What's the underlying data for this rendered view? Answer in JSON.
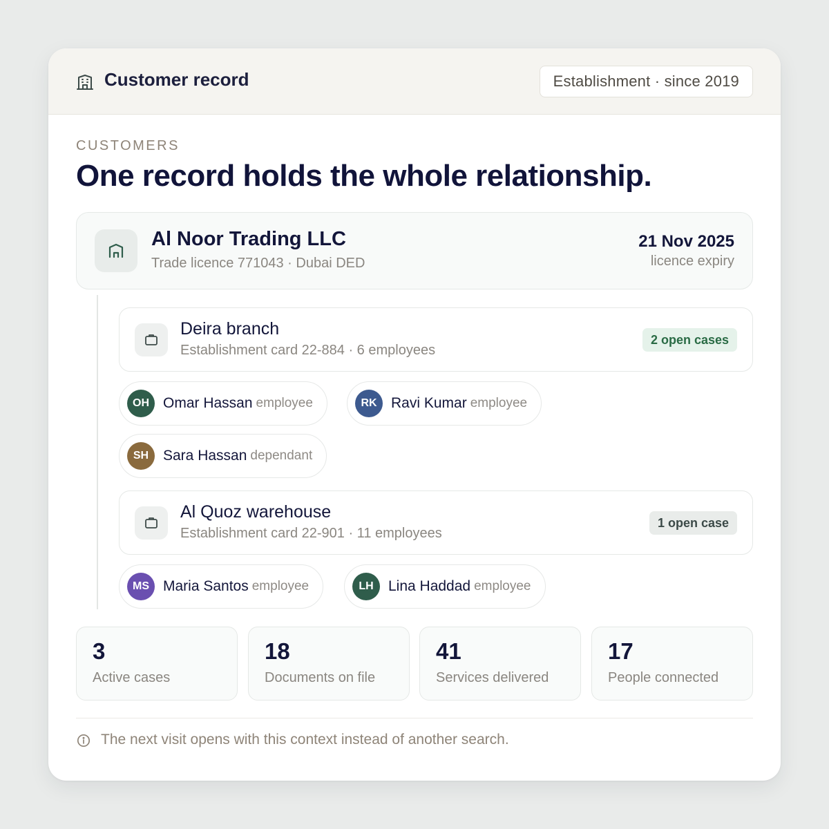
{
  "header": {
    "title": "Customer record",
    "badge": "Establishment · since 2019"
  },
  "section": {
    "eyebrow": "CUSTOMERS",
    "headline": "One record holds the whole relationship."
  },
  "organization": {
    "name": "Al Noor Trading LLC",
    "subtitle": "Trade licence 771043 · Dubai DED",
    "expiry_date": "21 Nov 2025",
    "expiry_label": "licence expiry"
  },
  "branches": [
    {
      "name": "Deira branch",
      "subtitle": "Establishment card 22-884 · 6 employees",
      "cases": "2 open cases",
      "people": [
        {
          "initials": "OH",
          "name": "Omar Hassan",
          "role": "employee",
          "color": "#2f5d4b"
        },
        {
          "initials": "RK",
          "name": "Ravi Kumar",
          "role": "employee",
          "color": "#3d5a8f"
        },
        {
          "initials": "SH",
          "name": "Sara Hassan",
          "role": "dependant",
          "color": "#8a6a3d"
        }
      ]
    },
    {
      "name": "Al Quoz warehouse",
      "subtitle": "Establishment card 22-901 · 11 employees",
      "cases": "1 open case",
      "people": [
        {
          "initials": "MS",
          "name": "Maria Santos",
          "role": "employee",
          "color": "#6a4fb0"
        },
        {
          "initials": "LH",
          "name": "Lina Haddad",
          "role": "employee",
          "color": "#2f5d4b"
        }
      ]
    }
  ],
  "stats": [
    {
      "value": "3",
      "label": "Active cases"
    },
    {
      "value": "18",
      "label": "Documents on file"
    },
    {
      "value": "41",
      "label": "Services delivered"
    },
    {
      "value": "17",
      "label": "People connected"
    }
  ],
  "footer": {
    "note": "The next visit opens with this context instead of another search."
  },
  "icons": {
    "header": "building-icon",
    "organization": "storefront-icon",
    "branch": "briefcase-icon",
    "footer": "info-icon"
  }
}
